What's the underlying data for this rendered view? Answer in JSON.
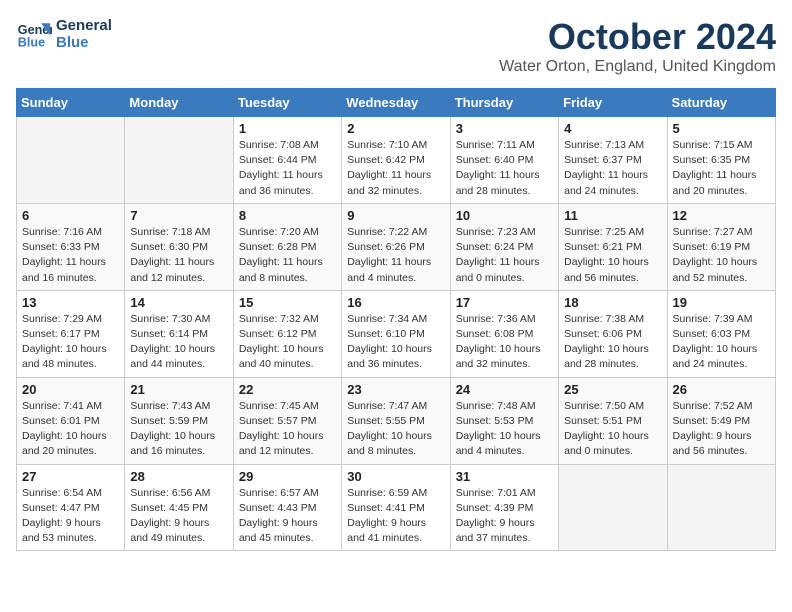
{
  "header": {
    "logo_line1": "General",
    "logo_line2": "Blue",
    "month": "October 2024",
    "location": "Water Orton, England, United Kingdom"
  },
  "columns": [
    "Sunday",
    "Monday",
    "Tuesday",
    "Wednesday",
    "Thursday",
    "Friday",
    "Saturday"
  ],
  "weeks": [
    [
      {
        "day": "",
        "info": ""
      },
      {
        "day": "",
        "info": ""
      },
      {
        "day": "1",
        "info": "Sunrise: 7:08 AM\nSunset: 6:44 PM\nDaylight: 11 hours and 36 minutes."
      },
      {
        "day": "2",
        "info": "Sunrise: 7:10 AM\nSunset: 6:42 PM\nDaylight: 11 hours and 32 minutes."
      },
      {
        "day": "3",
        "info": "Sunrise: 7:11 AM\nSunset: 6:40 PM\nDaylight: 11 hours and 28 minutes."
      },
      {
        "day": "4",
        "info": "Sunrise: 7:13 AM\nSunset: 6:37 PM\nDaylight: 11 hours and 24 minutes."
      },
      {
        "day": "5",
        "info": "Sunrise: 7:15 AM\nSunset: 6:35 PM\nDaylight: 11 hours and 20 minutes."
      }
    ],
    [
      {
        "day": "6",
        "info": "Sunrise: 7:16 AM\nSunset: 6:33 PM\nDaylight: 11 hours and 16 minutes."
      },
      {
        "day": "7",
        "info": "Sunrise: 7:18 AM\nSunset: 6:30 PM\nDaylight: 11 hours and 12 minutes."
      },
      {
        "day": "8",
        "info": "Sunrise: 7:20 AM\nSunset: 6:28 PM\nDaylight: 11 hours and 8 minutes."
      },
      {
        "day": "9",
        "info": "Sunrise: 7:22 AM\nSunset: 6:26 PM\nDaylight: 11 hours and 4 minutes."
      },
      {
        "day": "10",
        "info": "Sunrise: 7:23 AM\nSunset: 6:24 PM\nDaylight: 11 hours and 0 minutes."
      },
      {
        "day": "11",
        "info": "Sunrise: 7:25 AM\nSunset: 6:21 PM\nDaylight: 10 hours and 56 minutes."
      },
      {
        "day": "12",
        "info": "Sunrise: 7:27 AM\nSunset: 6:19 PM\nDaylight: 10 hours and 52 minutes."
      }
    ],
    [
      {
        "day": "13",
        "info": "Sunrise: 7:29 AM\nSunset: 6:17 PM\nDaylight: 10 hours and 48 minutes."
      },
      {
        "day": "14",
        "info": "Sunrise: 7:30 AM\nSunset: 6:14 PM\nDaylight: 10 hours and 44 minutes."
      },
      {
        "day": "15",
        "info": "Sunrise: 7:32 AM\nSunset: 6:12 PM\nDaylight: 10 hours and 40 minutes."
      },
      {
        "day": "16",
        "info": "Sunrise: 7:34 AM\nSunset: 6:10 PM\nDaylight: 10 hours and 36 minutes."
      },
      {
        "day": "17",
        "info": "Sunrise: 7:36 AM\nSunset: 6:08 PM\nDaylight: 10 hours and 32 minutes."
      },
      {
        "day": "18",
        "info": "Sunrise: 7:38 AM\nSunset: 6:06 PM\nDaylight: 10 hours and 28 minutes."
      },
      {
        "day": "19",
        "info": "Sunrise: 7:39 AM\nSunset: 6:03 PM\nDaylight: 10 hours and 24 minutes."
      }
    ],
    [
      {
        "day": "20",
        "info": "Sunrise: 7:41 AM\nSunset: 6:01 PM\nDaylight: 10 hours and 20 minutes."
      },
      {
        "day": "21",
        "info": "Sunrise: 7:43 AM\nSunset: 5:59 PM\nDaylight: 10 hours and 16 minutes."
      },
      {
        "day": "22",
        "info": "Sunrise: 7:45 AM\nSunset: 5:57 PM\nDaylight: 10 hours and 12 minutes."
      },
      {
        "day": "23",
        "info": "Sunrise: 7:47 AM\nSunset: 5:55 PM\nDaylight: 10 hours and 8 minutes."
      },
      {
        "day": "24",
        "info": "Sunrise: 7:48 AM\nSunset: 5:53 PM\nDaylight: 10 hours and 4 minutes."
      },
      {
        "day": "25",
        "info": "Sunrise: 7:50 AM\nSunset: 5:51 PM\nDaylight: 10 hours and 0 minutes."
      },
      {
        "day": "26",
        "info": "Sunrise: 7:52 AM\nSunset: 5:49 PM\nDaylight: 9 hours and 56 minutes."
      }
    ],
    [
      {
        "day": "27",
        "info": "Sunrise: 6:54 AM\nSunset: 4:47 PM\nDaylight: 9 hours and 53 minutes."
      },
      {
        "day": "28",
        "info": "Sunrise: 6:56 AM\nSunset: 4:45 PM\nDaylight: 9 hours and 49 minutes."
      },
      {
        "day": "29",
        "info": "Sunrise: 6:57 AM\nSunset: 4:43 PM\nDaylight: 9 hours and 45 minutes."
      },
      {
        "day": "30",
        "info": "Sunrise: 6:59 AM\nSunset: 4:41 PM\nDaylight: 9 hours and 41 minutes."
      },
      {
        "day": "31",
        "info": "Sunrise: 7:01 AM\nSunset: 4:39 PM\nDaylight: 9 hours and 37 minutes."
      },
      {
        "day": "",
        "info": ""
      },
      {
        "day": "",
        "info": ""
      }
    ]
  ]
}
